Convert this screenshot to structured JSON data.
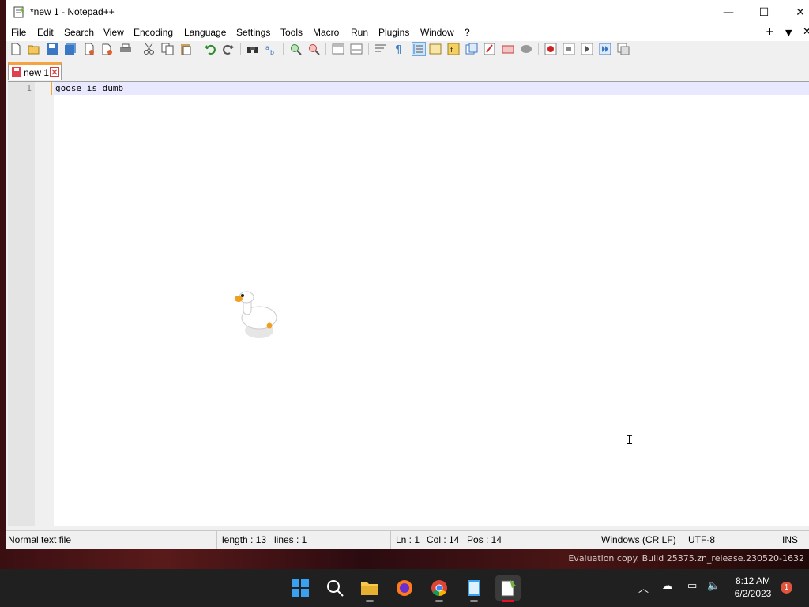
{
  "window": {
    "title": "*new 1 - Notepad++",
    "minimize_glyph": "—",
    "maximize_glyph": "☐",
    "close_glyph": "✕"
  },
  "menu": {
    "items": [
      "File",
      "Edit",
      "Search",
      "View",
      "Encoding",
      "Language",
      "Settings",
      "Tools",
      "Macro",
      "Run",
      "Plugins",
      "Window",
      "?"
    ],
    "right_plus": "+",
    "right_dropdown": "▼",
    "right_close": "✕"
  },
  "toolbar": {
    "buttons": [
      "new-icon",
      "open-icon",
      "save-icon",
      "save-all-icon",
      "close-icon",
      "close-all-icon",
      "print-icon",
      "cut-icon",
      "copy-icon",
      "paste-icon",
      "undo-icon",
      "redo-icon",
      "find-icon",
      "replace-icon",
      "zoom-in-icon",
      "zoom-out-icon",
      "sync-vertical-icon",
      "sync-horizontal-icon",
      "word-wrap-icon",
      "show-all-chars-icon",
      "indent-guide-icon",
      "document-map-icon",
      "function-list-icon",
      "folder-as-workspace-icon",
      "monitoring-icon",
      "udl-icon",
      "record-macro-icon",
      "stop-recording-icon",
      "playback-macro-icon",
      "run-macro-multiple-icon",
      "save-macro-icon"
    ]
  },
  "tabs": [
    {
      "label": "new 1",
      "modified": true
    }
  ],
  "editor": {
    "lines": [
      {
        "number": "1",
        "text": "goose is dumb"
      }
    ]
  },
  "status": {
    "file_type": "Normal text file",
    "length": "length : 13",
    "lines": "lines : 1",
    "ln": "Ln : 1",
    "col": "Col : 14",
    "pos": "Pos : 14",
    "eol": "Windows (CR LF)",
    "encoding": "UTF-8",
    "mode": "INS"
  },
  "desktop": {
    "watermark": "Evaluation copy. Build 25375.zn_release.230520-1632"
  },
  "taskbar": {
    "apps": [
      "start-icon",
      "search-icon",
      "file-explorer-icon",
      "firefox-icon",
      "chrome-icon",
      "notepad-icon",
      "notepadpp-icon"
    ],
    "time": "8:12 AM",
    "date": "6/2/2023",
    "notification_count": "1"
  },
  "colors": {
    "accent_tab": "#f4a340",
    "current_line": "#e8e8ff",
    "taskbar": "#202020"
  }
}
